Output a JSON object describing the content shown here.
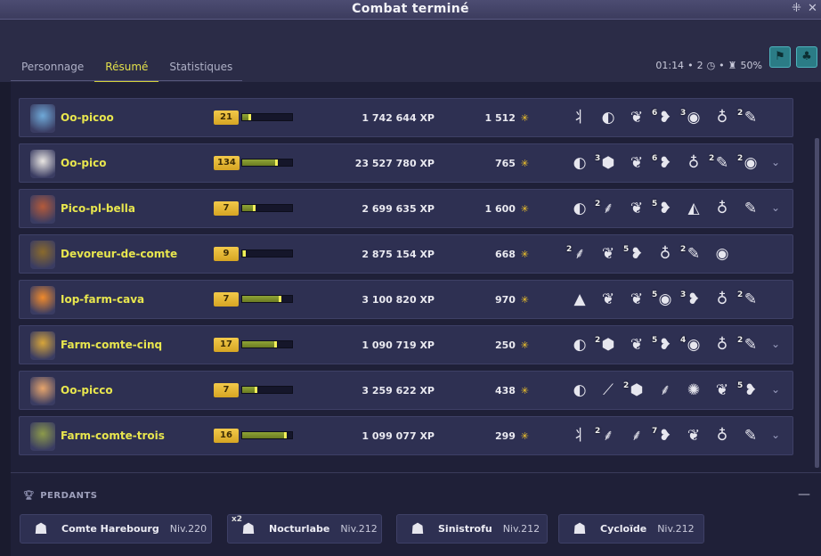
{
  "window": {
    "title": "Combat terminé",
    "controls": [
      "⁜",
      "✕"
    ]
  },
  "tabs": [
    {
      "label": "Personnage",
      "active": false
    },
    {
      "label": "Résumé",
      "active": true
    },
    {
      "label": "Statistiques",
      "active": false
    }
  ],
  "fight_info": {
    "duration": "01:14",
    "turns": "2",
    "turns_icon": "clock-icon",
    "challenge": "50%",
    "challenge_icon": "challenge-icon"
  },
  "colors": {
    "accent": "#e2e04a",
    "gold": "#f3c52a",
    "row_bg": "#2e3052"
  },
  "players": [
    {
      "name": "Oo-picoo",
      "level": "21",
      "xp_progress": 0.18,
      "xp": "1 742 644",
      "xp_unit": "XP",
      "kamas": "1 512",
      "avatar_icon": "avatar-blue-panda",
      "expandable": false,
      "items": [
        {
          "icon": "branch-icon",
          "glyph": "⺦",
          "qty": ""
        },
        {
          "icon": "shell-icon",
          "glyph": "◐",
          "qty": ""
        },
        {
          "icon": "feather-icon",
          "glyph": "❦",
          "qty": ""
        },
        {
          "icon": "red-fish-icon",
          "glyph": "❥",
          "qty": "6"
        },
        {
          "icon": "gold-orb-icon",
          "glyph": "◉",
          "qty": "3"
        },
        {
          "icon": "potion-icon",
          "glyph": "♁",
          "qty": ""
        },
        {
          "icon": "beak-icon",
          "glyph": "✎",
          "qty": "2"
        }
      ]
    },
    {
      "name": "Oo-pico",
      "level": "134",
      "xp_progress": 0.72,
      "xp": "23 527 780",
      "xp_unit": "XP",
      "kamas": "765",
      "avatar_icon": "avatar-panda-mask",
      "expandable": true,
      "items": [
        {
          "icon": "shell-icon",
          "glyph": "◐",
          "qty": ""
        },
        {
          "icon": "stone-icon",
          "glyph": "⬢",
          "qty": "3"
        },
        {
          "icon": "feather-icon",
          "glyph": "❦",
          "qty": ""
        },
        {
          "icon": "red-fish-icon",
          "glyph": "❥",
          "qty": "6"
        },
        {
          "icon": "potion-icon",
          "glyph": "♁",
          "qty": ""
        },
        {
          "icon": "beak-icon",
          "glyph": "✎",
          "qty": "2"
        },
        {
          "icon": "gold-orb-icon",
          "glyph": "◉",
          "qty": "2"
        }
      ]
    },
    {
      "name": "Pico-pl-bella",
      "level": "7",
      "xp_progress": 0.26,
      "xp": "2 699 635",
      "xp_unit": "XP",
      "kamas": "1 600",
      "avatar_icon": "avatar-red-warrior",
      "expandable": true,
      "items": [
        {
          "icon": "shell-icon",
          "glyph": "◐",
          "qty": ""
        },
        {
          "icon": "claw-icon",
          "glyph": "⸙",
          "qty": "2"
        },
        {
          "icon": "feather-icon",
          "glyph": "❦",
          "qty": ""
        },
        {
          "icon": "red-fish-icon",
          "glyph": "❥",
          "qty": "5"
        },
        {
          "icon": "blade-icon",
          "glyph": "◭",
          "qty": ""
        },
        {
          "icon": "potion-icon",
          "glyph": "♁",
          "qty": ""
        },
        {
          "icon": "beak-icon",
          "glyph": "✎",
          "qty": ""
        }
      ]
    },
    {
      "name": "Devoreur-de-comte",
      "level": "9",
      "xp_progress": 0.08,
      "xp": "2 875 154",
      "xp_unit": "XP",
      "kamas": "668",
      "avatar_icon": "avatar-brown-beast",
      "expandable": false,
      "items": [
        {
          "icon": "claw-icon",
          "glyph": "⸙",
          "qty": "2"
        },
        {
          "icon": "feather-icon",
          "glyph": "❦",
          "qty": ""
        },
        {
          "icon": "red-fish-icon",
          "glyph": "❥",
          "qty": "5"
        },
        {
          "icon": "potion-icon",
          "glyph": "♁",
          "qty": ""
        },
        {
          "icon": "beak-icon",
          "glyph": "✎",
          "qty": "2"
        },
        {
          "icon": "gold-orb-icon",
          "glyph": "◉",
          "qty": ""
        }
      ]
    },
    {
      "name": "Iop-farm-cava",
      "level": "7",
      "xp_progress": 0.78,
      "xp": "3 100 820",
      "xp_unit": "XP",
      "kamas": "970",
      "avatar_icon": "avatar-flame-iop",
      "expandable": false,
      "items": [
        {
          "icon": "cone-icon",
          "glyph": "▲",
          "qty": ""
        },
        {
          "icon": "feather-icon",
          "glyph": "❦",
          "qty": ""
        },
        {
          "icon": "feather-icon",
          "glyph": "❦",
          "qty": ""
        },
        {
          "icon": "gold-orb-icon",
          "glyph": "◉",
          "qty": "5"
        },
        {
          "icon": "red-fish-icon",
          "glyph": "❥",
          "qty": "3"
        },
        {
          "icon": "potion-icon",
          "glyph": "♁",
          "qty": ""
        },
        {
          "icon": "beak-icon",
          "glyph": "✎",
          "qty": "2"
        }
      ]
    },
    {
      "name": "Farm-comte-cinq",
      "level": "17",
      "xp_progress": 0.7,
      "xp": "1 090 719",
      "xp_unit": "XP",
      "kamas": "250",
      "avatar_icon": "avatar-golden-lion",
      "expandable": true,
      "items": [
        {
          "icon": "shell-icon",
          "glyph": "◐",
          "qty": ""
        },
        {
          "icon": "stone-icon",
          "glyph": "⬢",
          "qty": "2"
        },
        {
          "icon": "feather-icon",
          "glyph": "❦",
          "qty": ""
        },
        {
          "icon": "red-fish-icon",
          "glyph": "❥",
          "qty": "5"
        },
        {
          "icon": "gold-orb-icon",
          "glyph": "◉",
          "qty": "4"
        },
        {
          "icon": "potion-icon",
          "glyph": "♁",
          "qty": ""
        },
        {
          "icon": "beak-icon",
          "glyph": "✎",
          "qty": "2"
        }
      ]
    },
    {
      "name": "Oo-picco",
      "level": "7",
      "xp_progress": 0.3,
      "xp": "3 259 622",
      "xp_unit": "XP",
      "kamas": "438",
      "avatar_icon": "avatar-orange-kid",
      "expandable": true,
      "items": [
        {
          "icon": "shell-icon",
          "glyph": "◐",
          "qty": ""
        },
        {
          "icon": "needle-icon",
          "glyph": "⟋",
          "qty": ""
        },
        {
          "icon": "stone-icon",
          "glyph": "⬢",
          "qty": "2"
        },
        {
          "icon": "dark-claw-icon",
          "glyph": "⸙",
          "qty": ""
        },
        {
          "icon": "orange-bug-icon",
          "glyph": "✺",
          "qty": ""
        },
        {
          "icon": "feather-icon",
          "glyph": "❦",
          "qty": ""
        },
        {
          "icon": "red-fish-icon",
          "glyph": "❥",
          "qty": "5"
        }
      ]
    },
    {
      "name": "Farm-comte-trois",
      "level": "16",
      "xp_progress": 0.9,
      "xp": "1 099 077",
      "xp_unit": "XP",
      "kamas": "299",
      "avatar_icon": "avatar-green-hood",
      "expandable": true,
      "items": [
        {
          "icon": "branch-icon",
          "glyph": "⺦",
          "qty": ""
        },
        {
          "icon": "claw-icon",
          "glyph": "⸙",
          "qty": "2"
        },
        {
          "icon": "dark-claw-icon",
          "glyph": "⸙",
          "qty": ""
        },
        {
          "icon": "red-fish-icon",
          "glyph": "❥",
          "qty": "7"
        },
        {
          "icon": "feather-icon",
          "glyph": "❦",
          "qty": ""
        },
        {
          "icon": "potion-icon",
          "glyph": "♁",
          "qty": ""
        },
        {
          "icon": "beak-icon",
          "glyph": "✎",
          "qty": ""
        }
      ]
    }
  ],
  "losers": {
    "title": "PERDANTS",
    "collapse_label": "—",
    "monsters": [
      {
        "name": "Comte Harebourg",
        "level": "Niv.220",
        "multiplier": "",
        "icon": "comte-harebourg-icon"
      },
      {
        "name": "Nocturlabe",
        "level": "Niv.212",
        "multiplier": "x2",
        "icon": "nocturlabe-icon"
      },
      {
        "name": "Sinistrofu",
        "level": "Niv.212",
        "multiplier": "",
        "icon": "sinistrofu-icon"
      },
      {
        "name": "Cycloïde",
        "level": "Niv.212",
        "multiplier": "",
        "icon": "cycloide-icon"
      }
    ]
  }
}
